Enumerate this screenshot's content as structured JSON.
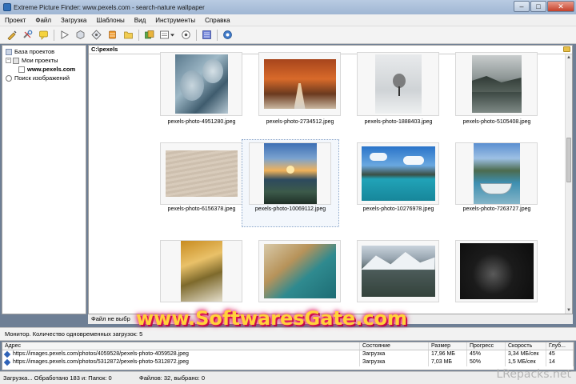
{
  "window": {
    "title": "Extreme Picture Finder: www.pexels.com - search-nature wallpaper",
    "controls": [
      "–",
      "□",
      "✕"
    ]
  },
  "menu": [
    "Проект",
    "Файл",
    "Загрузка",
    "Шаблоны",
    "Вид",
    "Инструменты",
    "Справка"
  ],
  "toolbar": {
    "buttons": [
      "new-project-icon",
      "settings-icon",
      "comment-icon",
      "play-icon",
      "stop-icon",
      "filter-icon",
      "database-icon",
      "folder-icon",
      "add-icon",
      "view-icon",
      "record-icon",
      "monitor-icon",
      "help-icon"
    ]
  },
  "tree": {
    "items": [
      {
        "label": "База проектов"
      },
      {
        "label": "Мои проекты"
      },
      {
        "label": "www.pexels.com"
      },
      {
        "label": "Поиск изображений"
      }
    ]
  },
  "content": {
    "path": "C:\\pexels",
    "thumbnails": [
      {
        "name": "pexels-photo-4951280.jpeg"
      },
      {
        "name": "pexels-photo-2734512.jpeg"
      },
      {
        "name": "pexels-photo-1888403.jpeg"
      },
      {
        "name": "pexels-photo-5105408.jpeg"
      },
      {
        "name": "pexels-photo-6156378.jpeg"
      },
      {
        "name": "pexels-photo-10069112.jpeg"
      },
      {
        "name": "pexels-photo-10276978.jpeg"
      },
      {
        "name": "pexels-photo-7263727.jpeg"
      },
      {
        "name": ""
      },
      {
        "name": ""
      },
      {
        "name": ""
      },
      {
        "name": ""
      }
    ],
    "status_line": "Файл не выбр"
  },
  "monitor": {
    "label": "Монитор. Количество одновременных загрузок: 5"
  },
  "downloads": {
    "columns": [
      "Адрес",
      "Состояние",
      "Размер",
      "Прогресс",
      "Скорость",
      "Глуб..."
    ],
    "rows": [
      {
        "url": "https://images.pexels.com/photos/4059528/pexels-photo-4059528.jpeg",
        "status": "Загрузка",
        "size": "17,96 МБ",
        "progress": "45%",
        "speed": "3,34 МБ/сек",
        "depth": "45"
      },
      {
        "url": "https://images.pexels.com/photos/5312872/pexels-photo-5312872.jpeg",
        "status": "Загрузка",
        "size": "7,03 МБ",
        "progress": "50%",
        "speed": "1,5 МБ/сек",
        "depth": "14"
      }
    ]
  },
  "statusbar": {
    "left": "Загрузка... Обработано 183 и: Папок: 0",
    "right": "Файлов: 32, выбрано: 0"
  },
  "watermarks": {
    "main": "www.SoftwaresGate.com",
    "corner": "LRepacks.net"
  }
}
